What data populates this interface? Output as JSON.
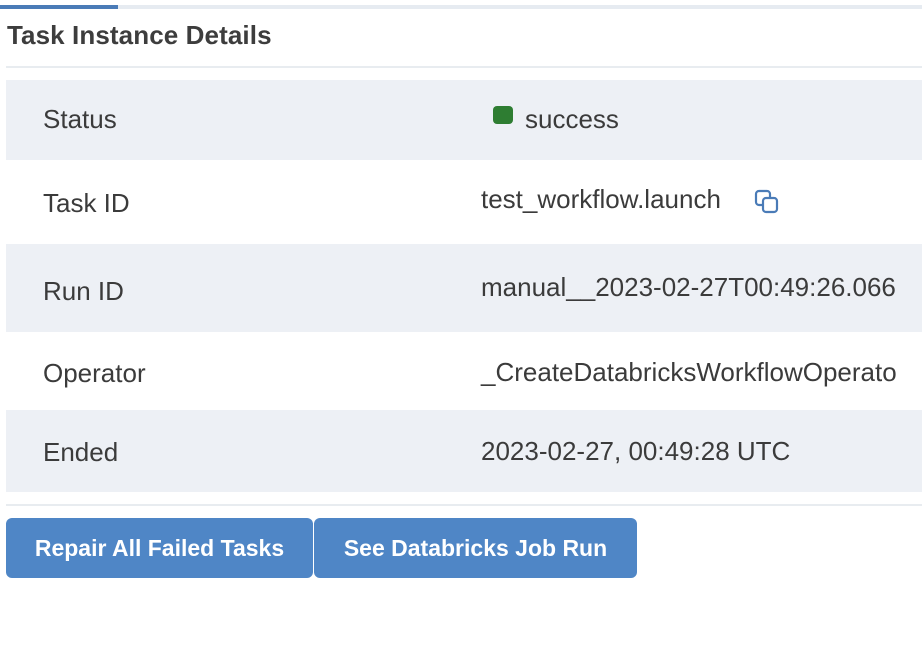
{
  "section": {
    "title": "Task Instance Details"
  },
  "details": {
    "status": {
      "label": "Status",
      "value": "success",
      "color": "#2e7d32"
    },
    "task_id": {
      "label": "Task ID",
      "value": "test_workflow.launch",
      "copy_icon": "copy-icon"
    },
    "run_id": {
      "label": "Run ID",
      "value": "manual__2023-02-27T00:49:26.066"
    },
    "operator": {
      "label": "Operator",
      "value": "_CreateDatabricksWorkflowOperato"
    },
    "ended": {
      "label": "Ended",
      "value": "2023-02-27, 00:49:28 UTC"
    }
  },
  "actions": {
    "repair_label": "Repair All Failed Tasks",
    "job_run_label": "See Databricks Job Run"
  },
  "colors": {
    "accent": "#4a7bb7",
    "button": "#4f86c6",
    "row_shade": "#edf0f5",
    "success": "#2e7d32"
  }
}
